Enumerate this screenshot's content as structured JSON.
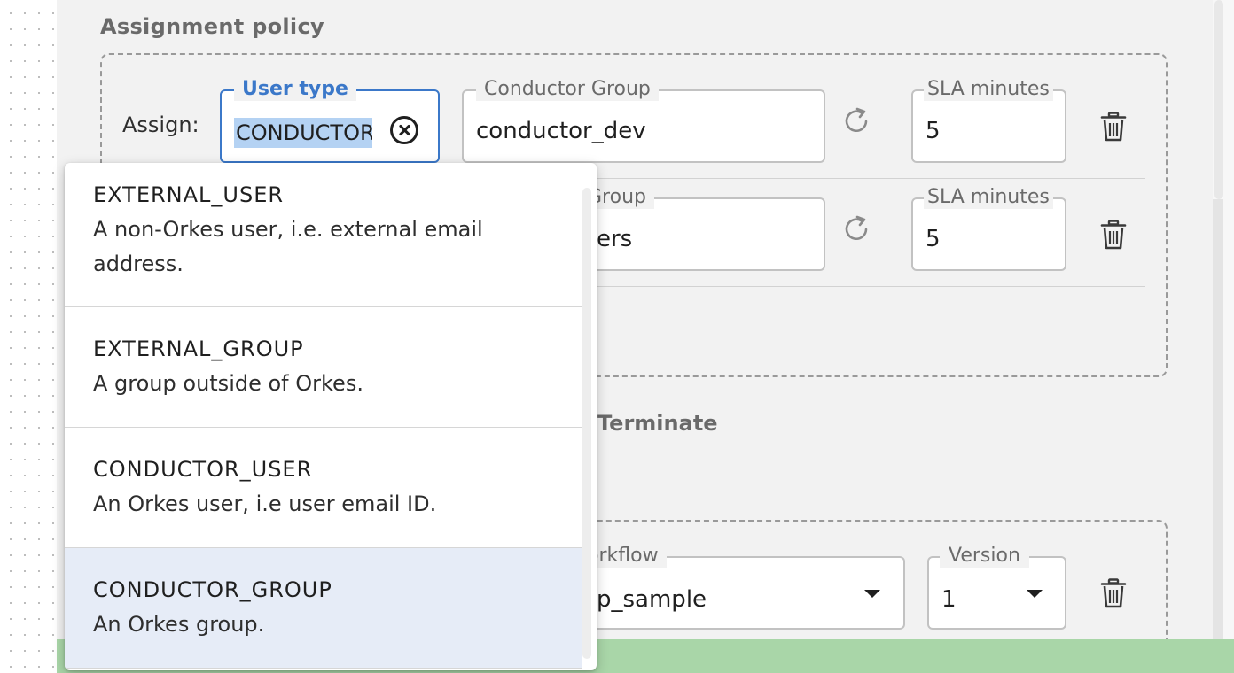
{
  "assignment_policy": {
    "title": "Assignment policy",
    "assign_label": "Assign:",
    "row1": {
      "user_type_label": "User type",
      "user_type_value": "CONDUCTOR",
      "group_label": "Conductor Group",
      "group_value": "conductor_dev",
      "sla_label": "SLA minutes",
      "sla_value": "5"
    },
    "row2": {
      "group_label": "Group",
      "group_value": "ers",
      "sla_label": "SLA minutes",
      "sla_value": "5"
    }
  },
  "terminate": {
    "title": "Terminate",
    "workflow_label": "orkflow",
    "workflow_value": "p_sample",
    "version_label": "Version",
    "version_value": "1"
  },
  "dropdown": {
    "options": [
      {
        "title": "EXTERNAL_USER",
        "desc": "A non-Orkes user, i.e. external email address."
      },
      {
        "title": "EXTERNAL_GROUP",
        "desc": "A group outside of Orkes."
      },
      {
        "title": "CONDUCTOR_USER",
        "desc": "An Orkes user, i.e user email ID."
      },
      {
        "title": "CONDUCTOR_GROUP",
        "desc": "An Orkes group."
      }
    ],
    "highlighted_index": 3
  },
  "icons": {
    "clear": "clear-circle-icon",
    "refresh": "refresh-icon",
    "delete": "trash-icon",
    "caret": "caret-down-icon"
  },
  "colors": {
    "accent": "#3b78c9",
    "selection": "#b4d2f3",
    "highlight": "#e6ecf7",
    "footer": "#a9d6a8"
  }
}
